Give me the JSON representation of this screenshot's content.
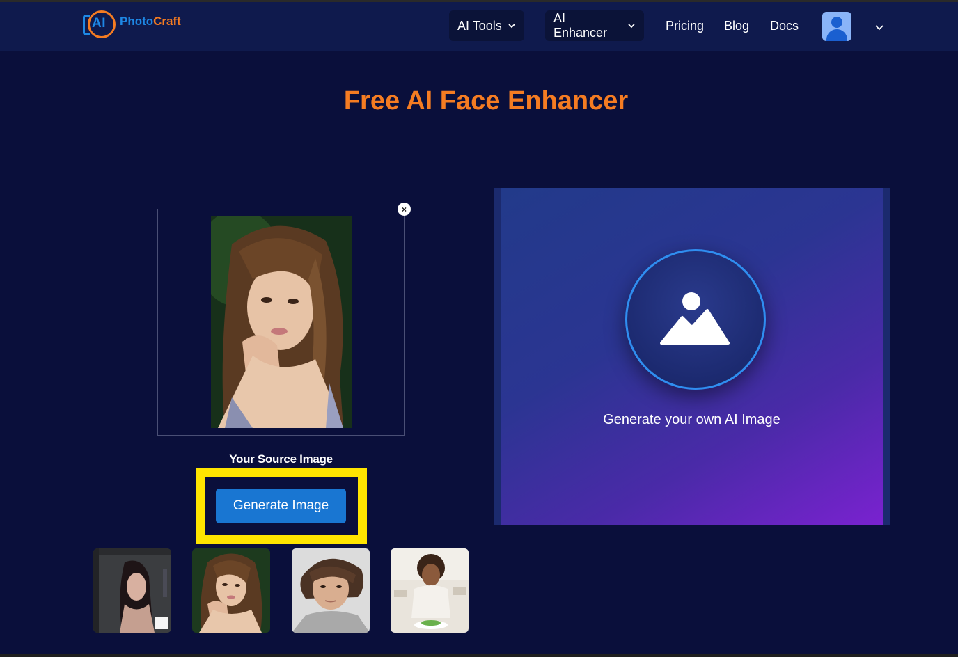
{
  "app": {
    "logo_ai": "AI",
    "logo_photo": "Photo",
    "logo_craft": "Craft"
  },
  "nav": {
    "ai_tools": "AI Tools",
    "ai_enhancer": "AI Enhancer",
    "pricing": "Pricing",
    "blog": "Blog",
    "docs": "Docs"
  },
  "page": {
    "title": "Free AI Face Enhancer"
  },
  "source": {
    "label": "Your Source Image",
    "close": "×"
  },
  "actions": {
    "generate_label": "Generate Image"
  },
  "result": {
    "placeholder_text": "Generate your own AI Image"
  },
  "thumbnails": [
    {
      "name": "thumbnail-3d-woman"
    },
    {
      "name": "thumbnail-woman-portrait"
    },
    {
      "name": "thumbnail-man-portrait"
    },
    {
      "name": "thumbnail-woman-salad"
    }
  ],
  "colors": {
    "background": "#0a0f3b",
    "header": "#0f1a4d",
    "accent_orange": "#f57c22",
    "accent_blue": "#1976d2",
    "highlight": "#ffe500"
  }
}
